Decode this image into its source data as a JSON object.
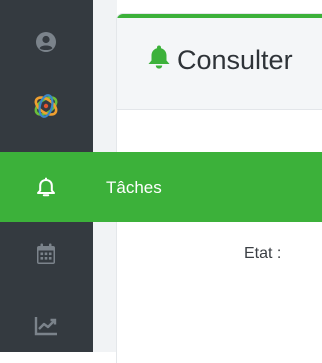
{
  "sidebar": {
    "items": [
      {
        "icon": "user-icon",
        "label": ""
      },
      {
        "icon": "logo-icon",
        "label": ""
      },
      {
        "icon": "bell-icon",
        "label": "Tâches",
        "active": true
      },
      {
        "icon": "calendar-icon",
        "label": ""
      },
      {
        "icon": "chart-line-icon",
        "label": ""
      }
    ]
  },
  "card": {
    "title": "Consulter",
    "title_icon": "bell-icon"
  },
  "form": {
    "etat_label": "Etat :"
  },
  "colors": {
    "accent": "#3cb13a",
    "sidebar_bg": "#343a40",
    "sidebar_icon": "#7b838b",
    "header_bg": "#f4f6f8"
  }
}
